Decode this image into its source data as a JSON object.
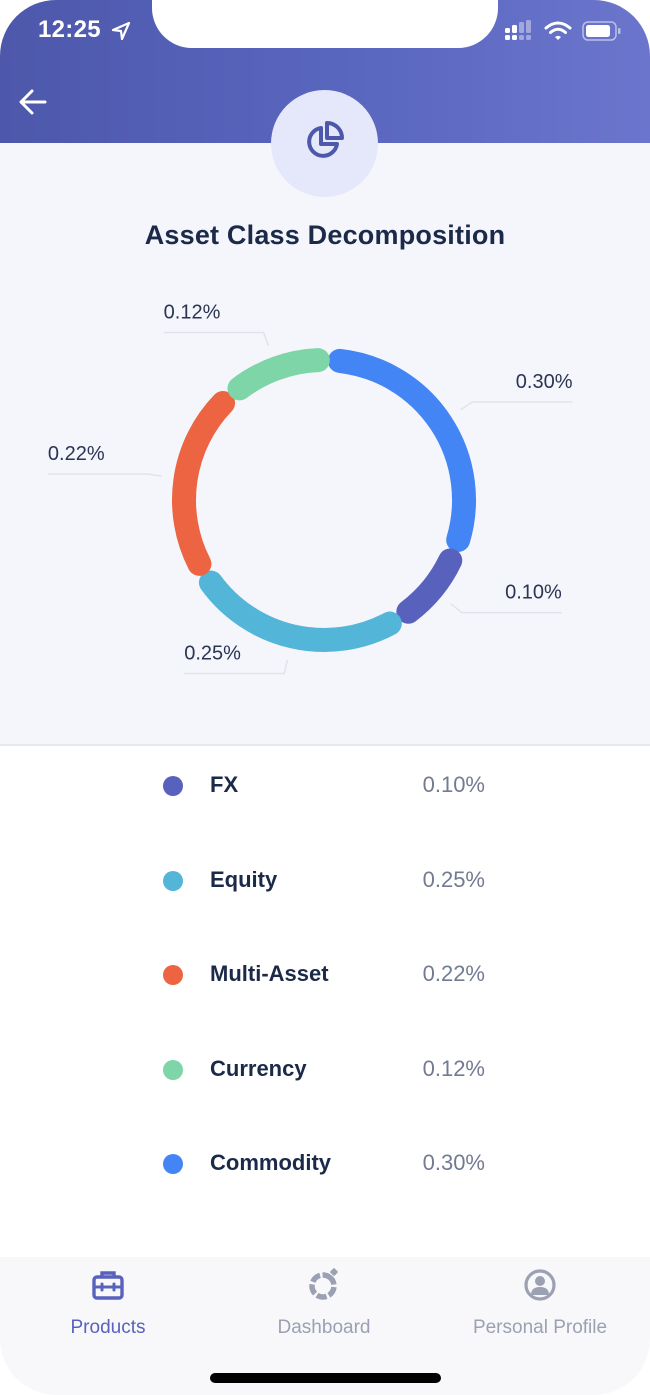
{
  "status_bar": {
    "time": "12:25",
    "location_icon": "location-arrow-icon",
    "signal_icon": "cellular-signal-icon",
    "wifi_icon": "wifi-icon",
    "battery_icon": "battery-icon"
  },
  "header": {
    "back_icon": "arrow-left-icon",
    "badge_icon": "pie-chart-icon"
  },
  "page": {
    "title": "Asset Class Decomposition"
  },
  "colors": {
    "header_start": "#4d58ab",
    "header_end": "#6b75cc",
    "fx": "#5862bd",
    "equity": "#53b5d7",
    "multi_asset": "#ec6441",
    "currency": "#7dd5a8",
    "commodity": "#4485f5",
    "active_tab": "#5862bd",
    "inactive_tab": "#9ba1b2"
  },
  "chart_data": {
    "type": "pie",
    "variant": "donut",
    "title": "Asset Class Decomposition",
    "unit": "%",
    "start": "top",
    "direction": "clockwise",
    "categories": [
      "Commodity",
      "FX",
      "Equity",
      "Multi-Asset",
      "Currency"
    ],
    "values": [
      0.3,
      0.1,
      0.25,
      0.22,
      0.12
    ],
    "labels": [
      "0.30%",
      "0.10%",
      "0.25%",
      "0.22%",
      "0.12%"
    ],
    "colors": [
      "#4485f5",
      "#5862bd",
      "#53b5d7",
      "#ec6441",
      "#7dd5a8"
    ],
    "legend": "below"
  },
  "legend": [
    {
      "name": "FX",
      "value": "0.10%",
      "color": "#5862bd"
    },
    {
      "name": "Equity",
      "value": "0.25%",
      "color": "#53b5d7"
    },
    {
      "name": "Multi-Asset",
      "value": "0.22%",
      "color": "#ec6441"
    },
    {
      "name": "Currency",
      "value": "0.12%",
      "color": "#7dd5a8"
    },
    {
      "name": "Commodity",
      "value": "0.30%",
      "color": "#4485f5"
    }
  ],
  "tabbar": {
    "tabs": [
      {
        "label": "Products",
        "icon": "briefcase-icon",
        "active": true
      },
      {
        "label": "Dashboard",
        "icon": "dashboard-ring-icon",
        "active": false
      },
      {
        "label": "Personal Profile",
        "icon": "user-circle-icon",
        "active": false
      }
    ]
  }
}
